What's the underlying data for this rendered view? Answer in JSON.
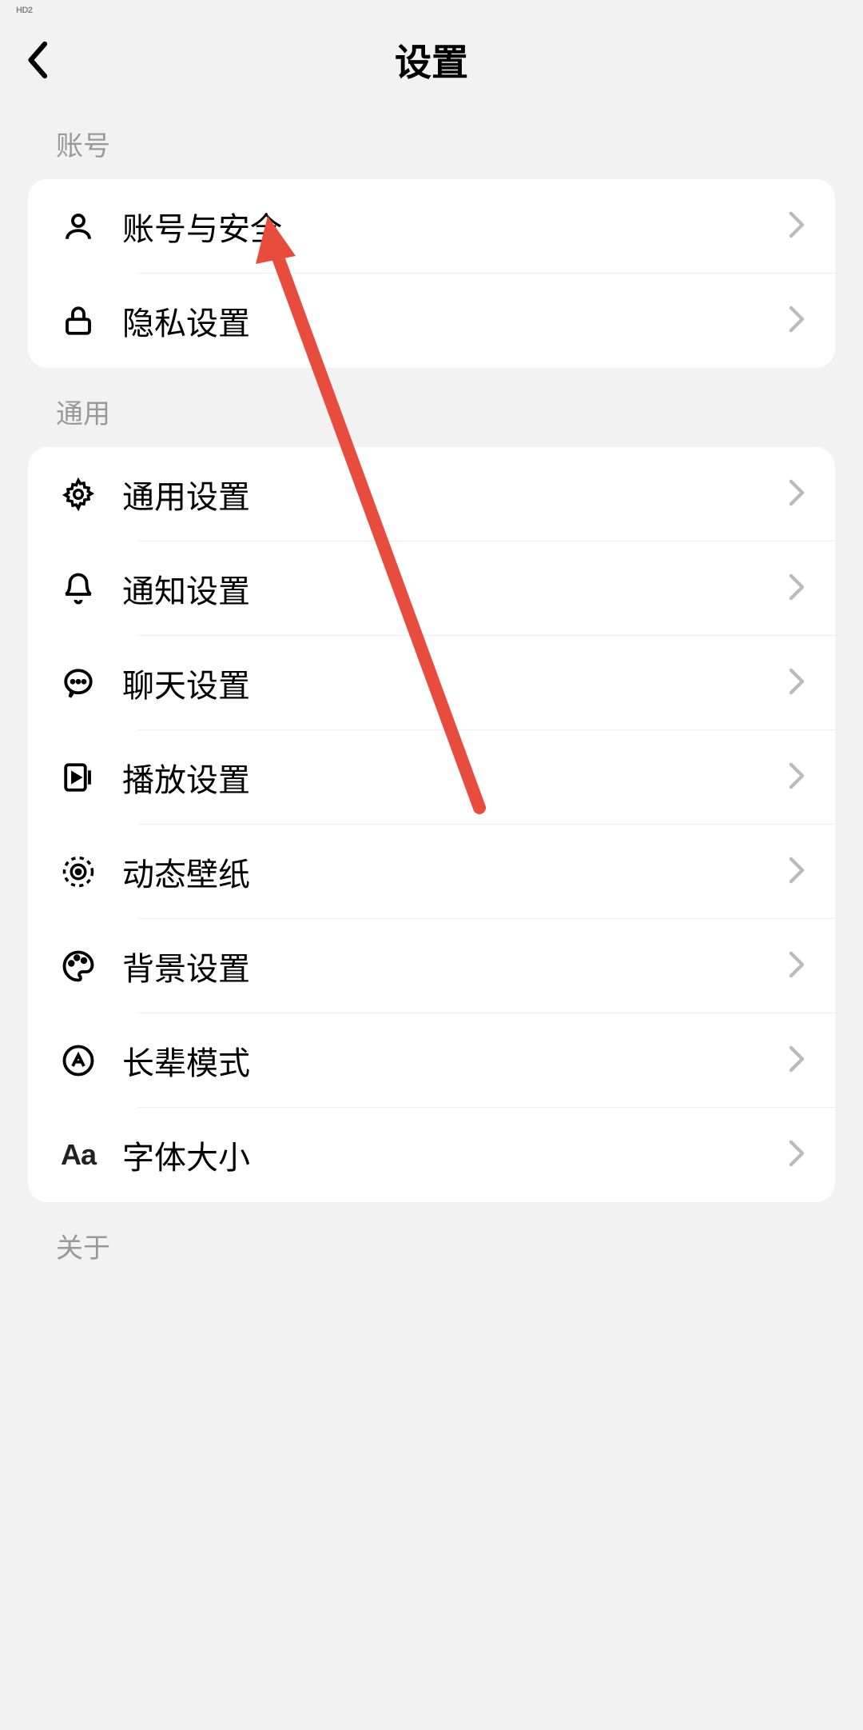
{
  "statusBar": {
    "indicator": "HD2"
  },
  "header": {
    "title": "设置"
  },
  "sections": {
    "account": {
      "label": "账号",
      "items": [
        {
          "label": "账号与安全",
          "icon": "person-icon"
        },
        {
          "label": "隐私设置",
          "icon": "lock-icon"
        }
      ]
    },
    "general": {
      "label": "通用",
      "items": [
        {
          "label": "通用设置",
          "icon": "gear-icon"
        },
        {
          "label": "通知设置",
          "icon": "bell-icon"
        },
        {
          "label": "聊天设置",
          "icon": "chat-icon"
        },
        {
          "label": "播放设置",
          "icon": "play-icon"
        },
        {
          "label": "动态壁纸",
          "icon": "wallpaper-icon"
        },
        {
          "label": "背景设置",
          "icon": "palette-icon"
        },
        {
          "label": "长辈模式",
          "icon": "elder-mode-icon"
        },
        {
          "label": "字体大小",
          "icon": "font-size-icon"
        }
      ]
    },
    "about": {
      "label": "关于"
    }
  },
  "annotation": {
    "arrowColor": "#e74c3c"
  }
}
